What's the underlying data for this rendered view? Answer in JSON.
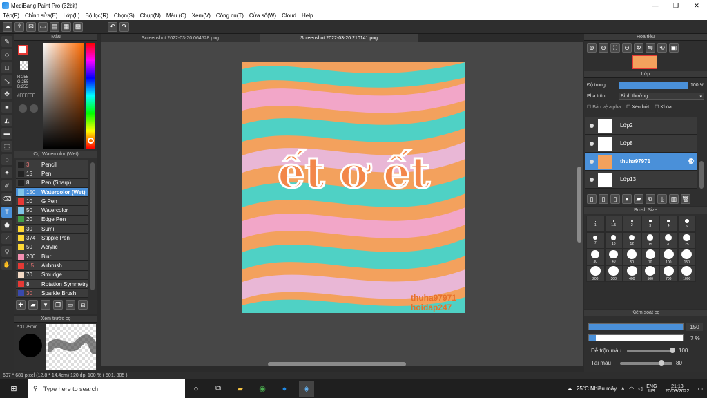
{
  "window": {
    "title": "MediBang Paint Pro (32bit)",
    "minimize": "—",
    "maximize": "❐",
    "close": "✕"
  },
  "menu": [
    "Tệp(F)",
    "Chỉnh sửa(E)",
    "Lớp(L)",
    "Bộ lọc(R)",
    "Chọn(S)",
    "Chụp(N)",
    "Màu (C)",
    "Xem(V)",
    "Công cụ(T)",
    "Cửa sổ(W)",
    "Cloud",
    "Help"
  ],
  "color_panel": {
    "title": "Màu",
    "r": "R:255",
    "g": "G:255",
    "b": "B:255",
    "hex": "#FFFFFF"
  },
  "brush_panel": {
    "title": "Cọ: Watercolor (Wet)",
    "items": [
      {
        "size": "3",
        "name": "Pencil",
        "color": "#222222"
      },
      {
        "size": "15",
        "name": "Pen",
        "color": "#222222"
      },
      {
        "size": "8",
        "name": "Pen (Sharp)",
        "color": "#222222"
      },
      {
        "size": "150",
        "name": "Watercolor (Wet)",
        "color": "#7fc4e8"
      },
      {
        "size": "10",
        "name": "G Pen",
        "color": "#e53935"
      },
      {
        "size": "50",
        "name": "Watercolor",
        "color": "#7fc4e8"
      },
      {
        "size": "20",
        "name": "Edge Pen",
        "color": "#43a047"
      },
      {
        "size": "30",
        "name": "Sumi",
        "color": "#fdd835"
      },
      {
        "size": "374",
        "name": "Stipple Pen",
        "color": "#fdd835"
      },
      {
        "size": "50",
        "name": "Acrylic",
        "color": "#fdd835"
      },
      {
        "size": "200",
        "name": "Blur",
        "color": "#f48fb1"
      },
      {
        "size": "1.5",
        "name": "Airbrush",
        "color": "#e53935"
      },
      {
        "size": "70",
        "name": "Smudge",
        "color": "#f3d9c4"
      },
      {
        "size": "8",
        "name": "Rotation Symmetry",
        "color": "#e53935"
      },
      {
        "size": "30",
        "name": "Sparkle Brush",
        "color": "#3949ab"
      }
    ]
  },
  "preview_panel": {
    "title": "Xem trước cọ",
    "size": "* 31.75mm"
  },
  "tabs": [
    "Screenshot 2022-03-20 064528.png",
    "Screenshot 2022-03-20 210141.png"
  ],
  "artwork": {
    "text": "ết ơ ết",
    "watermark1": "thuha97971",
    "watermark2": "hoidap247"
  },
  "nav_panel": {
    "title": "Hoa tiêu"
  },
  "layer_panel": {
    "title": "Lớp",
    "opacity_label": "Độ trong",
    "opacity_value": "100 %",
    "blend_label": "Pha trộn",
    "blend_value": "Bình thường",
    "protect_alpha": "Bảo vệ alpha",
    "clipping": "Xén bớt",
    "lock": "Khóa",
    "layers": [
      {
        "name": "Lớp2",
        "active": false
      },
      {
        "name": "Lớp8",
        "active": false
      },
      {
        "name": "thuha97971",
        "active": true
      },
      {
        "name": "Lớp13",
        "active": false
      }
    ]
  },
  "brush_size": {
    "title": "Brush Size",
    "sizes": [
      "1",
      "1.5",
      "2",
      "3",
      "4",
      "6",
      "7",
      "10",
      "12",
      "15",
      "20",
      "25",
      "30",
      "40",
      "50",
      "70",
      "100",
      "150",
      "200",
      "300",
      "400",
      "500",
      "700",
      "1000"
    ]
  },
  "brush_control": {
    "title": "Kiểm soát cọ",
    "size_value": "150",
    "opacity_value": "7 %",
    "blend_label": "Dễ trộn màu",
    "blend_value": "100",
    "reload_label": "Tải màu",
    "reload_value": "80"
  },
  "status": "607 * 681 pixel   (12.8 * 14.4cm)   120 dpi   100 %   ( 501, 805 )",
  "taskbar": {
    "search": "Type here to search",
    "weather": "25°C  Nhiều mây",
    "lang1": "ENG",
    "lang2": "US",
    "time": "21:18",
    "date": "20/03/2022"
  }
}
